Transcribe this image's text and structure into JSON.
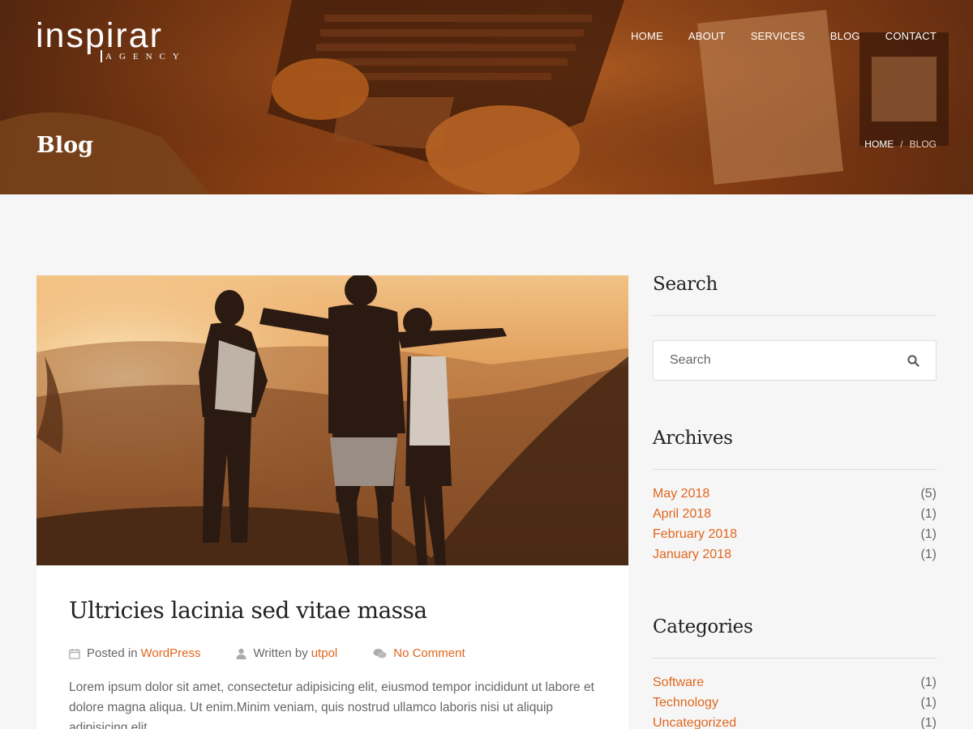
{
  "brand": {
    "name": "inspirar",
    "tagline": "AGENCY"
  },
  "nav": [
    "HOME",
    "ABOUT",
    "SERVICES",
    "BLOG",
    "CONTACT"
  ],
  "hero": {
    "title": "Blog",
    "breadcrumb": {
      "home": "HOME",
      "sep": "/",
      "current": "BLOG"
    }
  },
  "post": {
    "title": "Ultricies lacinia sed vitae massa",
    "meta": {
      "posted_in_label": "Posted in",
      "category": "WordPress",
      "written_by_label": "Written by",
      "author": "utpol",
      "comments": "No Comment"
    },
    "excerpt": "Lorem ipsum dolor sit amet, consectetur adipisicing elit, eiusmod tempor incididunt ut labore et dolore magna aliqua. Ut enim.Minim veniam, quis nostrud ullamco laboris nisi ut aliquip adipisicing elit."
  },
  "sidebar": {
    "search": {
      "title": "Search",
      "placeholder": "Search"
    },
    "archives": {
      "title": "Archives",
      "items": [
        {
          "label": "May 2018",
          "count": "(5)"
        },
        {
          "label": "April 2018",
          "count": "(1)"
        },
        {
          "label": "February 2018",
          "count": "(1)"
        },
        {
          "label": "January 2018",
          "count": "(1)"
        }
      ]
    },
    "categories": {
      "title": "Categories",
      "items": [
        {
          "label": "Software",
          "count": "(1)"
        },
        {
          "label": "Technology",
          "count": "(1)"
        },
        {
          "label": "Uncategorized",
          "count": "(1)"
        }
      ]
    }
  },
  "colors": {
    "accent": "#e0661e",
    "hero_tint": "#a4541d",
    "heading": "#222222",
    "page_bg": "#f6f6f6"
  },
  "icons": {
    "search": "search-icon",
    "calendar": "calendar-icon",
    "user": "user-icon",
    "comment": "comment-icon"
  }
}
